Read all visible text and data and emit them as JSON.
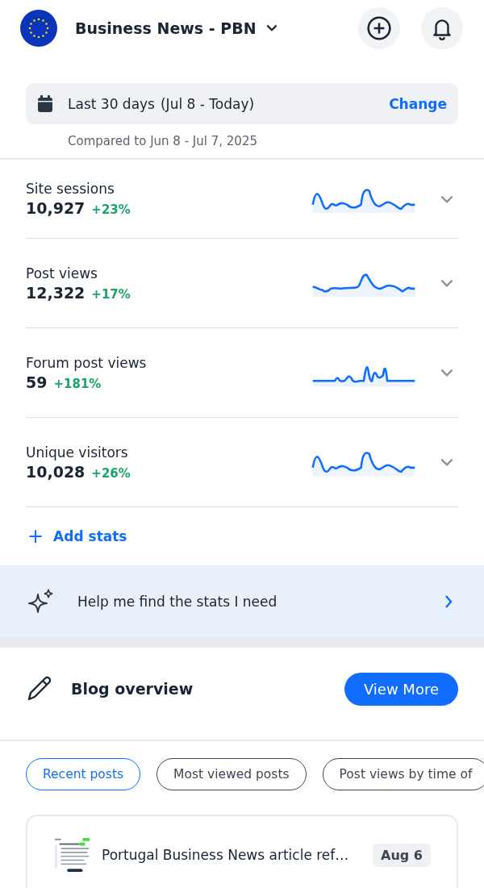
{
  "header": {
    "site_name": "Business News - PBN"
  },
  "date_range": {
    "label": "Last 30 days",
    "range": "(Jul 8 - Today)",
    "action": "Change",
    "comparison": "Compared to Jun 8 - Jul 7, 2025"
  },
  "stats": [
    {
      "name": "Site sessions",
      "value": "10,927",
      "change": "+23%",
      "expanded": false
    },
    {
      "name": "Post views",
      "value": "12,322",
      "change": "+17%",
      "expanded": false
    },
    {
      "name": "Forum post views",
      "value": "59",
      "change": "+181%",
      "expanded": false
    },
    {
      "name": "Unique visitors",
      "value": "10,028",
      "change": "+26%",
      "expanded": false
    }
  ],
  "add_stats": {
    "icon": "+",
    "label": "Add stats"
  },
  "assistant": {
    "label": "Help me find the stats I need"
  },
  "blog": {
    "title": "Blog overview",
    "action": "View More",
    "tabs": [
      {
        "label": "Recent posts",
        "selected": true
      },
      {
        "label": "Most viewed posts",
        "selected": false
      },
      {
        "label": "Post views by time of",
        "selected": false
      }
    ],
    "posts": [
      {
        "title": "Portugal Business News article ref…",
        "date": "Aug 6"
      }
    ]
  }
}
